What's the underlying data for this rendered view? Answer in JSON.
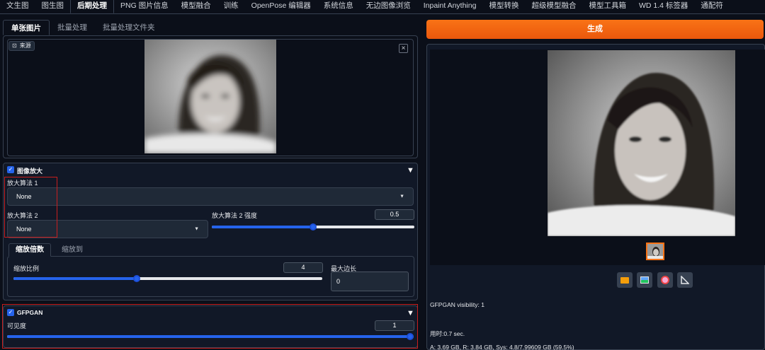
{
  "top_tabs": [
    "文生图",
    "图生图",
    "后期处理",
    "PNG 图片信息",
    "模型融合",
    "训练",
    "OpenPose 编辑器",
    "系统信息",
    "无边图像浏览",
    "Inpaint Anything",
    "模型转换",
    "超级模型融合",
    "模型工具箱",
    "WD 1.4 标签器",
    "通配符"
  ],
  "sub_tabs": [
    "单张图片",
    "批量处理",
    "批量处理文件夹"
  ],
  "source_label": "来源",
  "upscale": {
    "title": "图像放大",
    "upscaler1_label": "放大算法 1",
    "upscaler1_value": "None",
    "upscaler2_label": "放大算法 2",
    "upscaler2_value": "None",
    "upscaler2_strength_label": "放大算法 2 强度",
    "upscaler2_strength_value": "0.5",
    "upscaler2_strength_fraction": 0.5,
    "resize_tabs": [
      "缩放倍数",
      "缩放到"
    ],
    "scale_label": "缩放比例",
    "scale_value": "4",
    "scale_fraction": 0.4,
    "max_side_label": "最大边长",
    "max_side_value": "0"
  },
  "gfpgan": {
    "title": "GFPGAN",
    "visibility_label": "可见度",
    "visibility_value": "1",
    "visibility_fraction": 1.0
  },
  "generate_label": "生成",
  "tool_icons": [
    "folder-icon",
    "image-icon",
    "palette-icon",
    "ruler-icon"
  ],
  "output_info": {
    "gfpgan_line": "GFPGAN visibility: 1",
    "time_line": "用时:0.7 sec.",
    "memory_line": "A: 3.69 GB, R: 3.84 GB, Sys: 4.8/7.99609 GB (59.5%)"
  },
  "colors": {
    "accent": "#2563eb",
    "generate": "#f97316",
    "highlight": "#c81e1e"
  }
}
